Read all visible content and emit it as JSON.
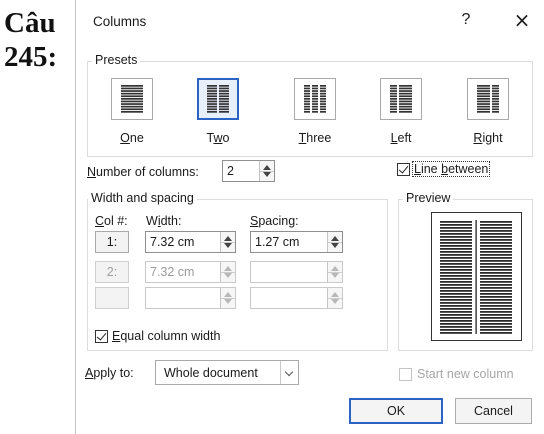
{
  "side_label": {
    "line1": "Câu",
    "line2": "245:"
  },
  "dialog": {
    "title": "Columns",
    "help": "?",
    "close": "×",
    "presets_label": "Presets",
    "presets": [
      {
        "key": "one",
        "pre": "",
        "mnemonic": "O",
        "post": "ne",
        "selected": false
      },
      {
        "key": "two",
        "pre": "T",
        "mnemonic": "w",
        "post": "o",
        "selected": true
      },
      {
        "key": "three",
        "pre": "",
        "mnemonic": "T",
        "post": "hree",
        "selected": false
      },
      {
        "key": "left",
        "pre": "",
        "mnemonic": "L",
        "post": "eft",
        "selected": false
      },
      {
        "key": "right",
        "pre": "",
        "mnemonic": "R",
        "post": "ight",
        "selected": false
      }
    ],
    "number_of_columns": {
      "mnemonic": "N",
      "rest": "umber of columns:",
      "value": "2"
    },
    "line_between": {
      "pre": "",
      "mnemonic": "L",
      "mid": "ine ",
      "mn2": "b",
      "post": "etween",
      "checked": true
    },
    "width_spacing_label": "Width and spacing",
    "col_header": {
      "mnemonic": "C",
      "rest": "ol #:"
    },
    "width_header": {
      "pre": "W",
      "mnemonic": "i",
      "post": "dth:"
    },
    "spacing_header": {
      "mnemonic": "S",
      "rest": "pacing:"
    },
    "rows": [
      {
        "col": "1:",
        "width": "7.32 cm",
        "spacing": "1.27 cm",
        "enabled": true
      },
      {
        "col": "2:",
        "width": "7.32 cm",
        "spacing": "",
        "enabled": false
      },
      {
        "col": "",
        "width": "",
        "spacing": "",
        "enabled": false
      }
    ],
    "equal_width": {
      "mnemonic": "E",
      "rest": "qual column width",
      "checked": true
    },
    "preview_label": "Preview",
    "apply_to": {
      "mnemonic": "A",
      "rest": "pply to:",
      "value": "Whole document"
    },
    "start_new_column": {
      "label": "Start new column",
      "checked": false
    },
    "ok": "OK",
    "cancel": "Cancel"
  }
}
